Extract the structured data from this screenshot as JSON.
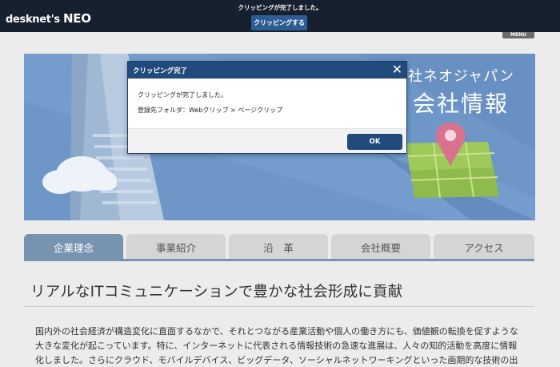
{
  "app": {
    "logo_text": "desknet's",
    "logo_neo": "NEO"
  },
  "clipping_bar": {
    "message": "クリッピングが完了しました。",
    "button_label": "クリッピングする"
  },
  "menu_label": "MENU",
  "banner": {
    "title_line1": "社ネオジャパン",
    "title_line2": "会社情報"
  },
  "tabs": [
    {
      "label": "企業理念",
      "active": true
    },
    {
      "label": "事業紹介",
      "active": false
    },
    {
      "label": "沿　革",
      "active": false
    },
    {
      "label": "会社概要",
      "active": false
    },
    {
      "label": "アクセス",
      "active": false
    }
  ],
  "heading": "リアルなITコミュニケーションで豊かな社会形成に貢献",
  "paragraph_lines": [
    "国内外の社会経済が構造変化に直面するなかで、それとつながる産業活動や個人の働き方にも、価値観の転換を促すような",
    "大きな変化が起こっています。特に、インターネットに代表される情報技術の急速な進展は、人々の知的活動を高度に情報",
    "化しました。さらにクラウド、モバイルデバイス、ビッグデータ、ソーシャルネットワーキングといった画期的な技術の出"
  ],
  "modal": {
    "title": "クリッピング完了",
    "message": "クリッピングが完了しました。",
    "folder_text": "登録先フォルダ：Webクリップ > ページクリップ",
    "ok_label": "OK"
  },
  "colors": {
    "topbar": "#16202e",
    "accent": "#234a7c",
    "tab_active": "#7694b0",
    "banner_bg": "#6e97c8"
  }
}
